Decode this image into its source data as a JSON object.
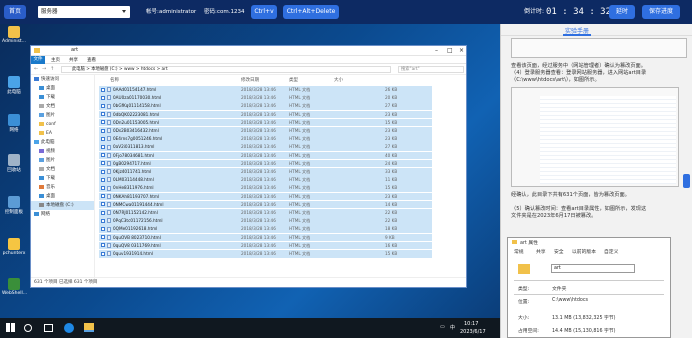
{
  "topbar": {
    "home_btn": "首页",
    "server_label": "服务器",
    "account_label": "帐号:",
    "account_value": "administrator",
    "password_label": "密码:",
    "password_value": "com.1234",
    "ctrlv": "Ctrl+v",
    "ctrlaltdel": "Ctrl+Alt+Delete",
    "countdown_label": "倒计时:",
    "countdown_value": "01 : 34 : 32",
    "delay_btn": "延时",
    "save_btn": "保存进度"
  },
  "desktop_icons": [
    "Administ...",
    "此电脑",
    "网络",
    "回收站",
    "控制面板",
    "pchunterx",
    "WebShell..."
  ],
  "explorer": {
    "title": "art",
    "ribbon": [
      "文件",
      "主页",
      "共享",
      "查看"
    ],
    "path": [
      "此电脑",
      "本地磁盘 (C:)",
      "www",
      "htdocs",
      "art"
    ],
    "search_placeholder": "搜索\"art\"",
    "nav": [
      {
        "label": "快速访问"
      },
      {
        "label": "桌面"
      },
      {
        "label": "下载"
      },
      {
        "label": "文档"
      },
      {
        "label": "图片"
      },
      {
        "label": "conf"
      },
      {
        "label": "EA"
      },
      {
        "label": "此电脑"
      },
      {
        "label": "视频"
      },
      {
        "label": "图片"
      },
      {
        "label": "文档"
      },
      {
        "label": "下载"
      },
      {
        "label": "音乐"
      },
      {
        "label": "桌面"
      },
      {
        "label": "本地磁盘 (C:)"
      },
      {
        "label": "网络"
      }
    ],
    "columns": [
      "名称",
      "修改日期",
      "类型",
      "大小"
    ],
    "files": [
      {
        "name": "0AAd01154147.html",
        "date": "2018/3/28 13:46",
        "type": "HTML 文档",
        "size": "26 KB"
      },
      {
        "name": "0AU0za01170030.html",
        "date": "2018/3/28 13:46",
        "type": "HTML 文档",
        "size": "20 KB"
      },
      {
        "name": "0bGfKq01114158.html",
        "date": "2018/3/28 13:46",
        "type": "HTML 文档",
        "size": "27 KB"
      },
      {
        "name": "0dbQK02223081.html",
        "date": "2018/3/28 13:46",
        "type": "HTML 文档",
        "size": "23 KB"
      },
      {
        "name": "0Dn2u01153005.html",
        "date": "2018/3/28 13:46",
        "type": "HTML 文档",
        "size": "15 KB"
      },
      {
        "name": "0Ds2B03416432.html",
        "date": "2018/3/28 13:46",
        "type": "HTML 文档",
        "size": "23 KB"
      },
      {
        "name": "0E4rns7g0051246.html",
        "date": "2018/3/28 13:46",
        "type": "HTML 文档",
        "size": "23 KB"
      },
      {
        "name": "0aV2i0311813.html",
        "date": "2018/3/28 13:46",
        "type": "HTML 文档",
        "size": "27 KB"
      },
      {
        "name": "0Fjo78034681.html",
        "date": "2018/3/28 13:46",
        "type": "HTML 文档",
        "size": "40 KB"
      },
      {
        "name": "0gB0294717.html",
        "date": "2018/3/28 13:46",
        "type": "HTML 文档",
        "size": "24 KB"
      },
      {
        "name": "0Kjz4011741.html",
        "date": "2018/3/28 13:46",
        "type": "HTML 文档",
        "size": "33 KB"
      },
      {
        "name": "0LM03114448.html",
        "date": "2018/3/28 13:46",
        "type": "HTML 文档",
        "size": "11 KB"
      },
      {
        "name": "0nHe8311976.html",
        "date": "2018/3/28 13:46",
        "type": "HTML 文档",
        "size": "15 KB"
      },
      {
        "name": "0NKAh81193707.html",
        "date": "2018/3/28 13:46",
        "type": "HTML 文档",
        "size": "23 KB"
      },
      {
        "name": "0NMCwa01191444.html",
        "date": "2018/3/28 13:46",
        "type": "HTML 文档",
        "size": "14 KB"
      },
      {
        "name": "0N7RJ01152142.html",
        "date": "2018/3/28 13:46",
        "type": "HTML 文档",
        "size": "22 KB"
      },
      {
        "name": "0PqC3tc01172156.html",
        "date": "2018/3/28 13:46",
        "type": "HTML 文档",
        "size": "22 KB"
      },
      {
        "name": "0QMe01192618.html",
        "date": "2018/3/28 13:46",
        "type": "HTML 文档",
        "size": "18 KB"
      },
      {
        "name": "0quOVB 8023710.html",
        "date": "2018/3/28 13:46",
        "type": "HTML 文档",
        "size": "9 KB"
      },
      {
        "name": "0quQV8 0311769.html",
        "date": "2018/3/28 13:46",
        "type": "HTML 文档",
        "size": "16 KB"
      },
      {
        "name": "0quv1931914.html",
        "date": "2018/3/28 13:46",
        "type": "HTML 文档",
        "size": "15 KB"
      }
    ],
    "status": "631 个项目    已选择 631 个项目"
  },
  "taskbar": {
    "time": "10:17",
    "date": "2023/6/17",
    "lang": "中"
  },
  "panel": {
    "tab": "实验手册",
    "para1": "查看该页面，经过服务中（网站管理者）确认为篡改页面。",
    "para2": "（4）登录服务器查看：登录网站服务器，进入网站art目录",
    "para3": "（C:\\www\\htdocs\\art\\），如图所示。",
    "para4": "经确认，此目录下共有631个页面，皆为篡改页面。",
    "para5": "（5）确认篡改时间：查看art目录属性，如图所示，发现这",
    "para6": "文件夹是在2023年6月17日被篡改。"
  },
  "props": {
    "title": "art 属性",
    "tabs": [
      "常规",
      "共享",
      "安全",
      "以前的版本",
      "自定义"
    ],
    "name": "art",
    "type_label": "类型:",
    "type_value": "文件夹",
    "loc_label": "位置:",
    "loc_value": "C:\\www\\htdocs",
    "size_label": "大小:",
    "size_value": "13.1 MB (13,832,325 字节)",
    "disk_label": "占用空间:",
    "disk_value": "14.4 MB (15,130,816 字节)"
  }
}
